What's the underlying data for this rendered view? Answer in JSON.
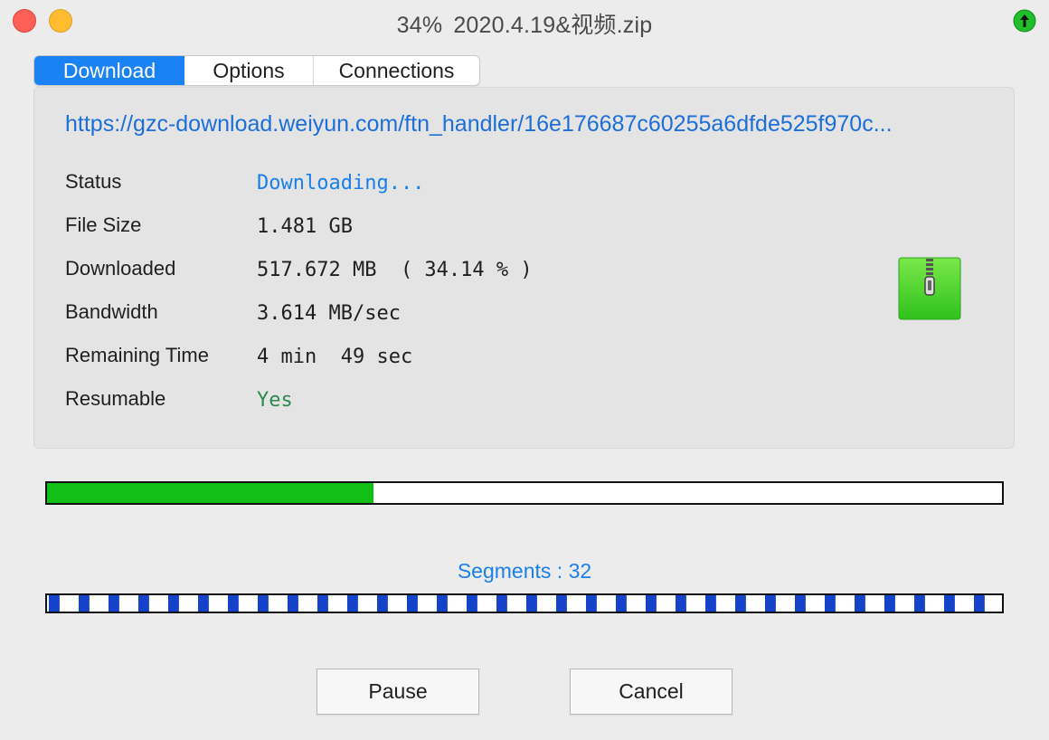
{
  "window": {
    "title_percent": "34%",
    "title_file": "2020.4.19&视频.zip"
  },
  "tabs": [
    {
      "label": "Download",
      "selected": true
    },
    {
      "label": "Options",
      "selected": false
    },
    {
      "label": "Connections",
      "selected": false
    }
  ],
  "download": {
    "url": "https://gzc-download.weiyun.com/ftn_handler/16e176687c60255a6dfde525f970c...",
    "rows": [
      {
        "label": "Status",
        "value": "Downloading..."
      },
      {
        "label": "File Size",
        "value": "1.481 GB"
      },
      {
        "label": "Downloaded",
        "value": "517.672 MB  ( 34.14 % )"
      },
      {
        "label": "Bandwidth",
        "value": "3.614 MB/sec"
      },
      {
        "label": "Remaining Time",
        "value": "4 min  49 sec"
      },
      {
        "label": "Resumable",
        "value": "Yes"
      }
    ],
    "file_icon": "zip-archive-icon"
  },
  "progress": {
    "fraction": 0.3414,
    "color": "#12bf16"
  },
  "segments": {
    "label": "Segments : 32",
    "count": 32,
    "color": "#1442c8"
  },
  "buttons": {
    "pause": "Pause",
    "cancel": "Cancel"
  },
  "colors": {
    "accent": "#1b82f3",
    "link": "#1c6ed8",
    "status": "#1b7fe8",
    "yes": "#2d8a4f"
  }
}
